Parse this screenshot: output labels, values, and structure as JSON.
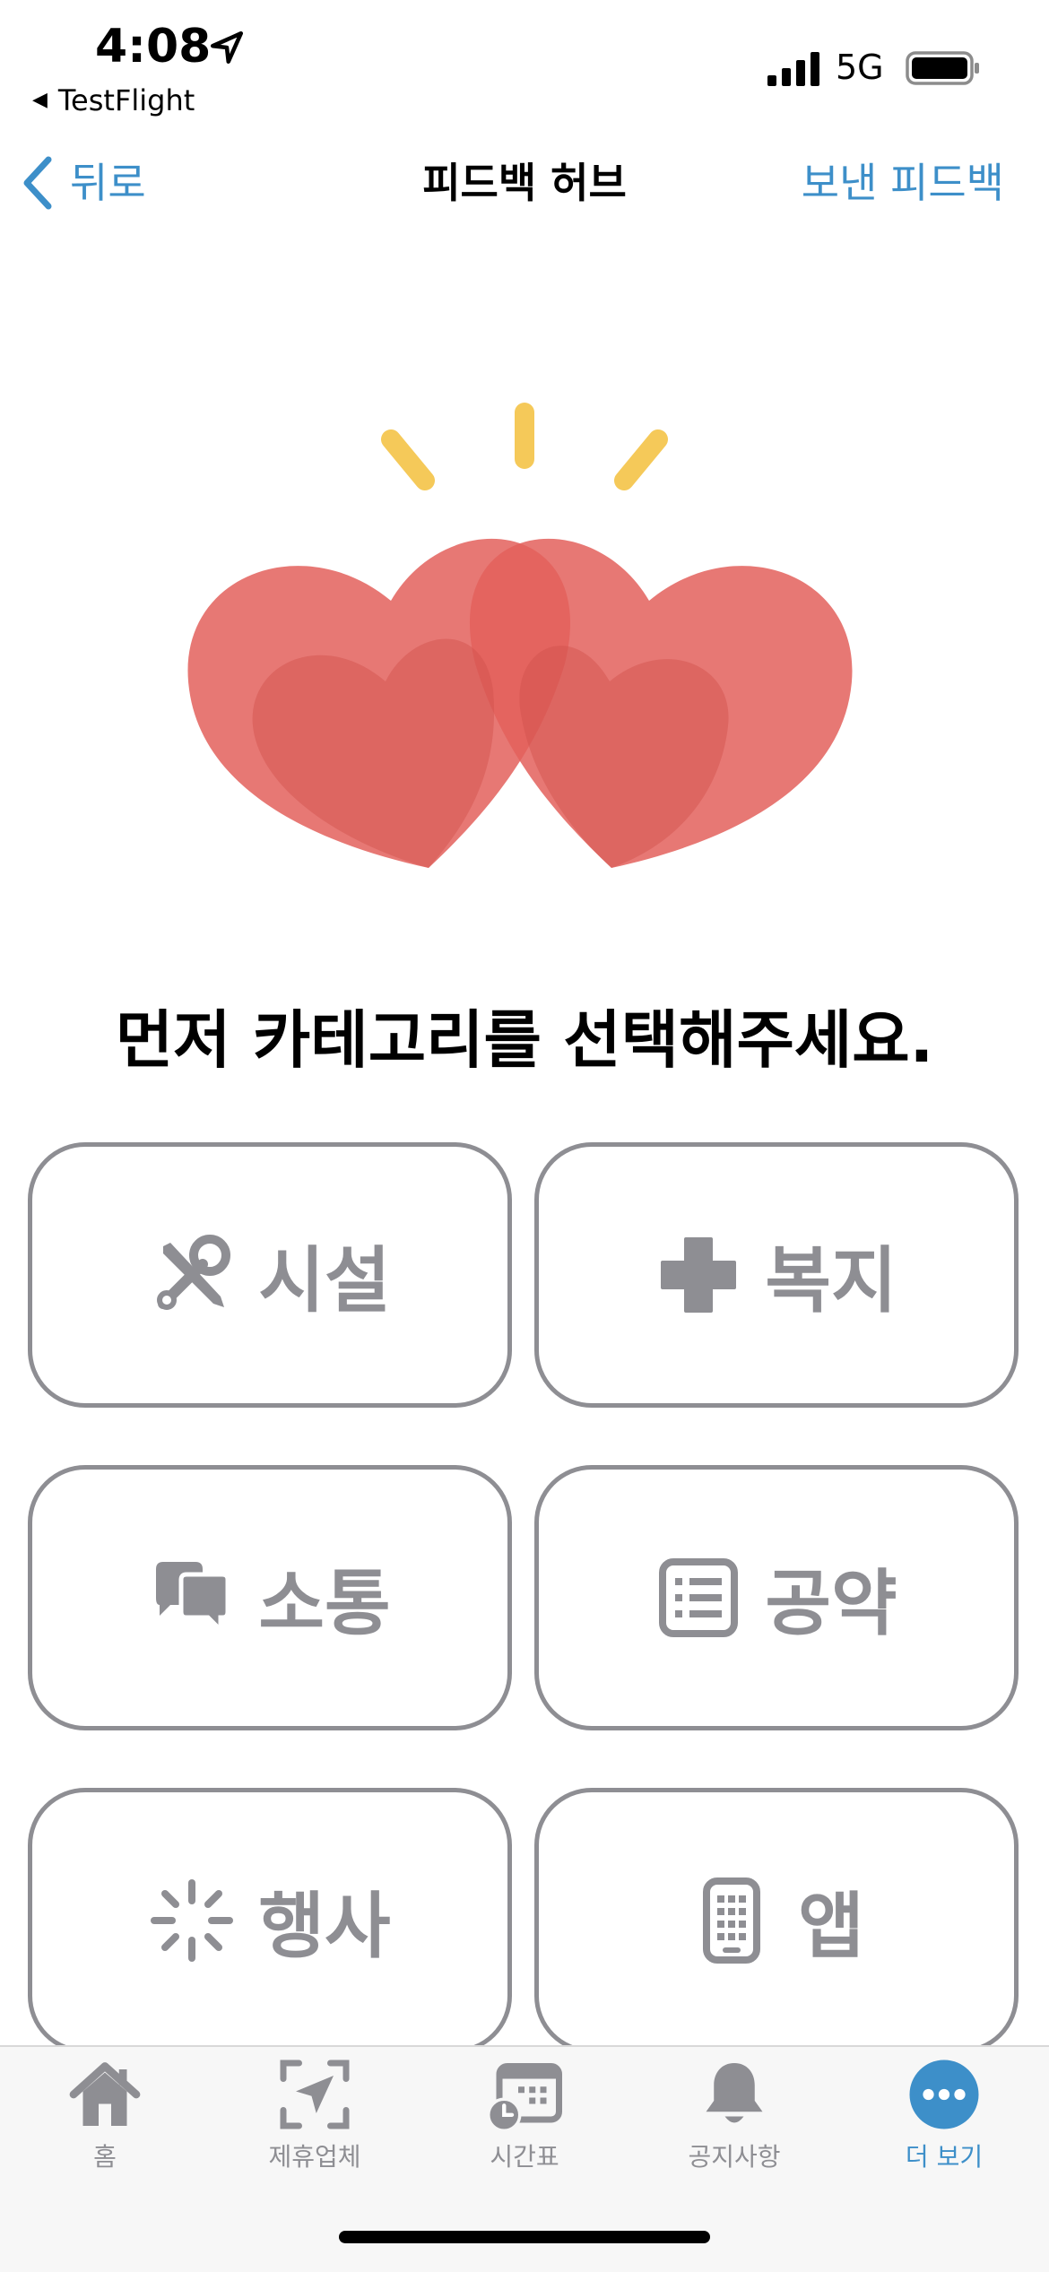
{
  "status": {
    "time": "4:08",
    "back_app": "TestFlight",
    "network": "5G"
  },
  "nav": {
    "back_label": "뒤로",
    "title": "피드백 허브",
    "right_label": "보낸 피드백"
  },
  "main": {
    "prompt": "먼저 카테고리를 선택해주세요.",
    "categories": [
      {
        "label": "시설",
        "icon": "tools-icon"
      },
      {
        "label": "복지",
        "icon": "plus-cross-icon"
      },
      {
        "label": "소통",
        "icon": "chat-bubbles-icon"
      },
      {
        "label": "공약",
        "icon": "list-document-icon"
      },
      {
        "label": "행사",
        "icon": "sparkle-icon"
      },
      {
        "label": "앱",
        "icon": "phone-app-icon"
      }
    ]
  },
  "tabbar": {
    "items": [
      {
        "label": "홈",
        "icon": "home-icon"
      },
      {
        "label": "제휴업체",
        "icon": "location-scan-icon"
      },
      {
        "label": "시간표",
        "icon": "calendar-clock-icon"
      },
      {
        "label": "공지사항",
        "icon": "bell-icon"
      },
      {
        "label": "더 보기",
        "icon": "more-icon"
      }
    ],
    "active_index": 4
  },
  "colors": {
    "accent": "#3d8fc9",
    "heart": "#e3605c",
    "burst": "#f5c959",
    "category_gray": "#8e8e93"
  }
}
